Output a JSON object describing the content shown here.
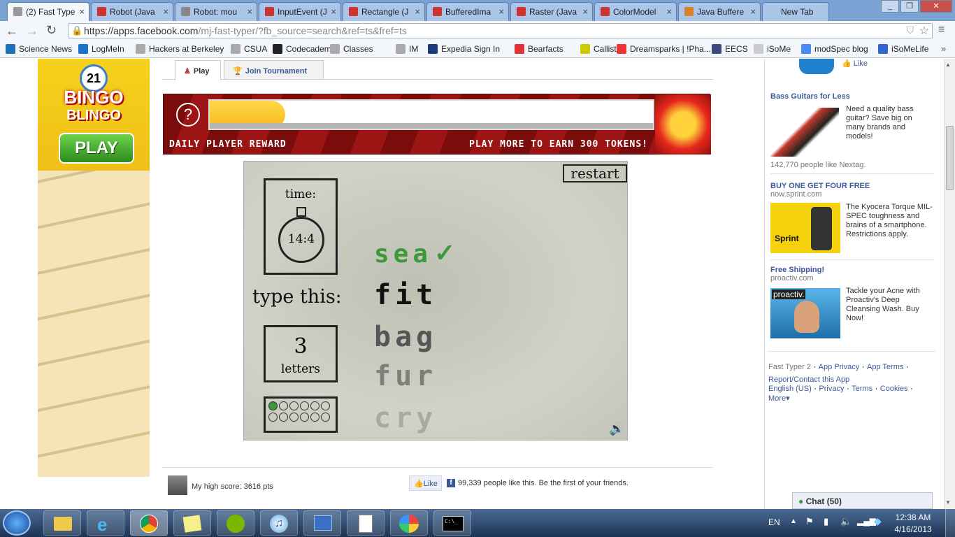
{
  "browser": {
    "tabs": [
      {
        "label": "(2) Fast Type",
        "active": true
      },
      {
        "label": "Robot (Java"
      },
      {
        "label": "Robot: mou"
      },
      {
        "label": "InputEvent (J"
      },
      {
        "label": "Rectangle (J"
      },
      {
        "label": "BufferedIma"
      },
      {
        "label": "Raster (Java"
      },
      {
        "label": "ColorModel"
      },
      {
        "label": "Java Buffere"
      },
      {
        "label": "New Tab"
      }
    ],
    "url_host": "https://apps.facebook.com",
    "url_path": "/mj-fast-typer/?fb_source=search&ref=ts&fref=ts",
    "bookmarks": [
      "Science News",
      "LogMeIn",
      "Hackers at Berkeley",
      "CSUA",
      "Codecademy",
      "Classes",
      "IM",
      "Expedia Sign In",
      "Bearfacts",
      "Callisto",
      "Dreamsparks | !Pha...",
      "EECS",
      "iSoMe",
      "modSpec blog",
      "iSoMeLife"
    ]
  },
  "app_tabs": {
    "play": "Play",
    "tournament": "Join Tournament"
  },
  "reward": {
    "help": "?",
    "left": "DAILY PLAYER REWARD",
    "right": "PLAY MORE TO EARN 300 TOKENS!",
    "progress": 0.17
  },
  "game": {
    "restart": "restart",
    "time_label": "time:",
    "time_value": "14:4",
    "type_this": "type this:",
    "done_word": "sea",
    "current_word": "fit",
    "next_words": [
      "bag",
      "fur",
      "cry"
    ],
    "letters_count": "3",
    "letters_label": "letters",
    "dots_filled": 1,
    "dots_total": 12
  },
  "bingo_ad": {
    "brand1": "BINGO",
    "brand2": "BLINGO",
    "cta": "PLAY",
    "ball": "21"
  },
  "footer": {
    "high_score": "My high score: 3616 pts",
    "like": "Like",
    "like_text": "99,339 people like this. Be the first of your friends."
  },
  "sidebar": {
    "top_like": "Like",
    "ads": [
      {
        "title": "Bass Guitars for Less",
        "domain": "",
        "text": "Need a quality bass guitar? Save big on many brands and models!",
        "social": "142,770 people like Nextag."
      },
      {
        "title": "BUY ONE GET FOUR FREE",
        "domain": "now.sprint.com",
        "text": "The Kyocera Torque MIL-SPEC toughness and brains of a smartphone. Restrictions apply.",
        "social": ""
      },
      {
        "title": "Free Shipping!",
        "domain": "proactiv.com",
        "text": "Tackle your Acne with Proactiv's Deep Cleansing Wash. Buy Now!",
        "social": ""
      }
    ],
    "links": [
      "Fast Typer 2",
      "App Privacy",
      "App Terms",
      "Report/Contact this App"
    ],
    "links2": [
      "English (US)",
      "Privacy",
      "Terms",
      "Cookies",
      "More"
    ],
    "sprint_logo": "Sprint",
    "proactiv_logo": "proactiv."
  },
  "chat": {
    "label": "Chat (50)"
  },
  "taskbar": {
    "lang": "EN",
    "time": "12:38 AM",
    "date": "4/16/2013"
  },
  "colors": {
    "fb_blue": "#3b5998",
    "green": "#3a9a3a",
    "reward_red": "#8c1010",
    "gold": "#f6c22b"
  }
}
